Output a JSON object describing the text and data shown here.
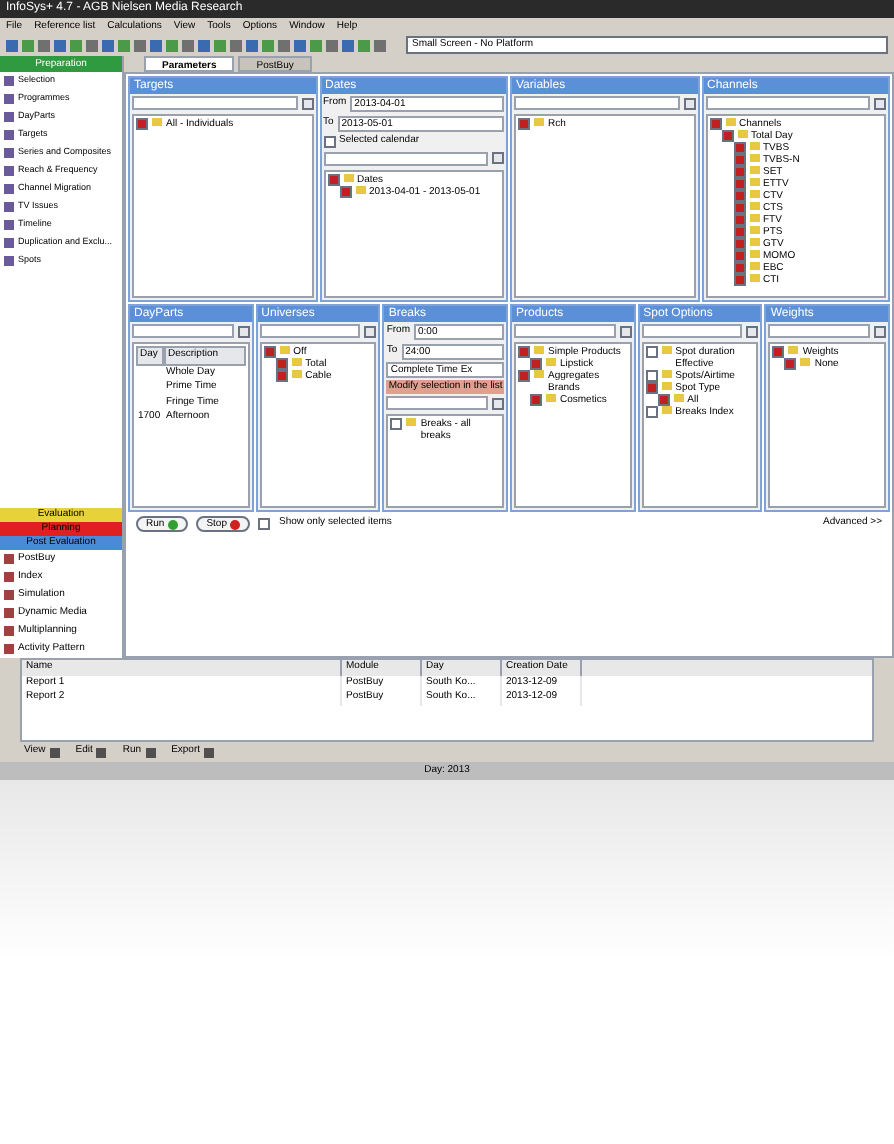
{
  "title": "InfoSys+ 4.7 - AGB Nielsen Media Research",
  "menu": [
    "File",
    "Reference list",
    "Calculations",
    "View",
    "Tools",
    "Options",
    "Window",
    "Help"
  ],
  "combo": {
    "value": "Small Screen - No Platform"
  },
  "tabs": [
    {
      "label": "Parameters",
      "selected": true
    },
    {
      "label": "PostBuy",
      "selected": false
    }
  ],
  "sidebar": {
    "header": "Preparation",
    "items": [
      "Selection",
      "Programmes",
      "DayParts",
      "Targets",
      "Series and Composites",
      "Reach & Frequency",
      "Channel Migration",
      "TV Issues",
      "Timeline",
      "Duplication and Exclu...",
      "Spots"
    ],
    "sections": [
      {
        "label": "Evaluation",
        "color": "#e8d23a"
      },
      {
        "label": "Planning",
        "color": "#e02020"
      },
      {
        "label": "Post Evaluation",
        "color": "#4a8ad8"
      }
    ],
    "reports": [
      "PostBuy",
      "Index",
      "Simulation",
      "Dynamic Media",
      "Multiplanning",
      "Activity Pattern"
    ]
  },
  "panels_top": [
    {
      "title": "Targets",
      "tree": [
        {
          "label": "All - Individuals",
          "checked": true
        }
      ]
    },
    {
      "title": "Dates",
      "fields": [
        {
          "label": "From",
          "value": "2013-04-01"
        },
        {
          "label": "To",
          "value": "2013-05-01"
        }
      ],
      "option": {
        "label": "Selected calendar",
        "checked": false
      },
      "tree": [
        {
          "label": "Dates",
          "checked": true,
          "children": [
            {
              "label": "2013-04-01 - 2013-05-01",
              "checked": true
            }
          ]
        }
      ]
    },
    {
      "title": "Variables",
      "tree": [
        {
          "label": "Rch",
          "checked": true
        }
      ]
    },
    {
      "title": "Channels",
      "tree": [
        {
          "label": "Channels",
          "checked": true,
          "children": [
            {
              "label": "Total Day",
              "checked": true,
              "children": [
                {
                  "label": "TVBS",
                  "checked": true
                },
                {
                  "label": "TVBS-N",
                  "checked": true
                },
                {
                  "label": "SET",
                  "checked": true
                },
                {
                  "label": "ETTV",
                  "checked": true
                },
                {
                  "label": "CTV",
                  "checked": true
                },
                {
                  "label": "CTS",
                  "checked": true
                },
                {
                  "label": "FTV",
                  "checked": true
                },
                {
                  "label": "PTS",
                  "checked": true
                },
                {
                  "label": "GTV",
                  "checked": true
                },
                {
                  "label": "MOMO",
                  "checked": true
                },
                {
                  "label": "EBC",
                  "checked": true
                },
                {
                  "label": "CTI",
                  "checked": true
                }
              ]
            }
          ]
        }
      ]
    }
  ],
  "panels_bottom": [
    {
      "title": "DayParts",
      "columns": [
        "Day",
        "Description"
      ],
      "rows": [
        {
          "description": "Whole Day"
        },
        {
          "description": "Prime Time"
        },
        {
          "description": "Fringe Time"
        },
        {
          "day": "1700",
          "description": "Afternoon"
        }
      ]
    },
    {
      "title": "Universes",
      "tree": [
        {
          "label": "Off",
          "checked": true,
          "children": [
            {
              "label": "Total",
              "checked": true
            },
            {
              "label": "Cable",
              "checked": true
            }
          ]
        }
      ]
    },
    {
      "title": "Breaks",
      "fields": [
        {
          "label": "From",
          "value": "0:00"
        },
        {
          "label": "To",
          "value": "24:00"
        }
      ],
      "subfield": "Complete Time Ex",
      "note": "Modify selection in the list",
      "tree": [
        {
          "label": "Breaks - all breaks",
          "checked": false
        }
      ]
    },
    {
      "title": "Products",
      "tree": [
        {
          "label": "Simple Products",
          "checked": true,
          "children": [
            {
              "label": "Lipstick",
              "checked": true
            }
          ]
        },
        {
          "label": "Aggregates Brands",
          "checked": true,
          "children": [
            {
              "label": "Cosmetics",
              "checked": true
            }
          ]
        }
      ]
    },
    {
      "title": "Spot Options",
      "tree": [
        {
          "label": "Spot duration Effective",
          "checked": false
        },
        {
          "label": "Spots/Airtime",
          "checked": false
        },
        {
          "label": "Spot Type",
          "checked": true,
          "children": [
            {
              "label": "All",
              "checked": true
            }
          ]
        },
        {
          "label": "Breaks Index",
          "checked": false
        }
      ]
    },
    {
      "title": "Weights",
      "tree": [
        {
          "label": "Weights",
          "checked": true,
          "children": [
            {
              "label": "None",
              "checked": true
            }
          ]
        }
      ]
    }
  ],
  "run": "Run",
  "stop": "Stop",
  "show_selected": {
    "label": "Show only selected items",
    "checked": false
  },
  "advanced": "Advanced >>",
  "table": {
    "columns": [
      "Name",
      "Module",
      "Day",
      "Creation Date"
    ],
    "rows": [
      [
        "Report 1",
        "PostBuy",
        "South Ko...",
        "2013-12-09"
      ],
      [
        "Report 2",
        "PostBuy",
        "South Ko...",
        "2013-12-09"
      ]
    ]
  },
  "table_toolbar": [
    "View",
    "Edit",
    "Run",
    "Export"
  ],
  "status": "Day: 2013"
}
